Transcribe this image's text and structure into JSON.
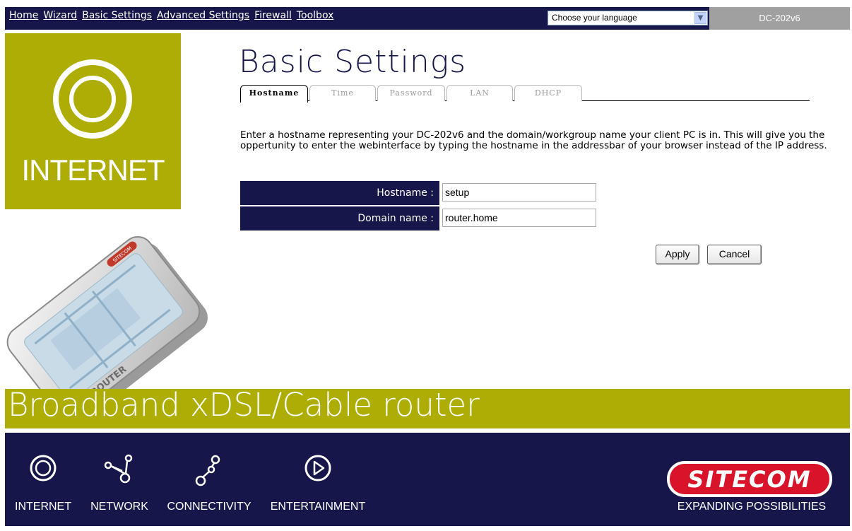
{
  "nav": {
    "items": [
      "Home",
      "Wizard",
      "Basic Settings",
      "Advanced Settings",
      "Firewall",
      "Toolbox"
    ]
  },
  "language_select": {
    "value": "Choose your language"
  },
  "model": "DC-202v6",
  "side_panel": {
    "label": "INTERNET"
  },
  "page_title": "Basic Settings",
  "tabs": [
    "Hostname",
    "Time",
    "Password",
    "LAN",
    "DHCP"
  ],
  "active_tab": "Hostname",
  "description": "Enter a hostname representing your DC-202v6 and the domain/workgroup name your client PC is in. This will give you the oppertunity to enter the webinterface by typing the hostname in the addressbar of your browser instead of the IP address.",
  "form": {
    "hostname_label": "Hostname :",
    "hostname_value": "setup",
    "domain_label": "Domain name :",
    "domain_value": "router.home"
  },
  "buttons": {
    "apply": "Apply",
    "cancel": "Cancel"
  },
  "router_image": {
    "brand": "SITECOM",
    "label": "ROUTER"
  },
  "banner": "Broadband xDSL/Cable router",
  "footer": {
    "items": [
      "INTERNET",
      "NETWORK",
      "CONNECTIVITY",
      "ENTERTAINMENT"
    ],
    "brand": "SITECOM",
    "tagline": "EXPANDING POSSIBILITIES"
  },
  "colors": {
    "navy": "#16164a",
    "olive": "#aead05",
    "brand_red": "#d8132a"
  }
}
